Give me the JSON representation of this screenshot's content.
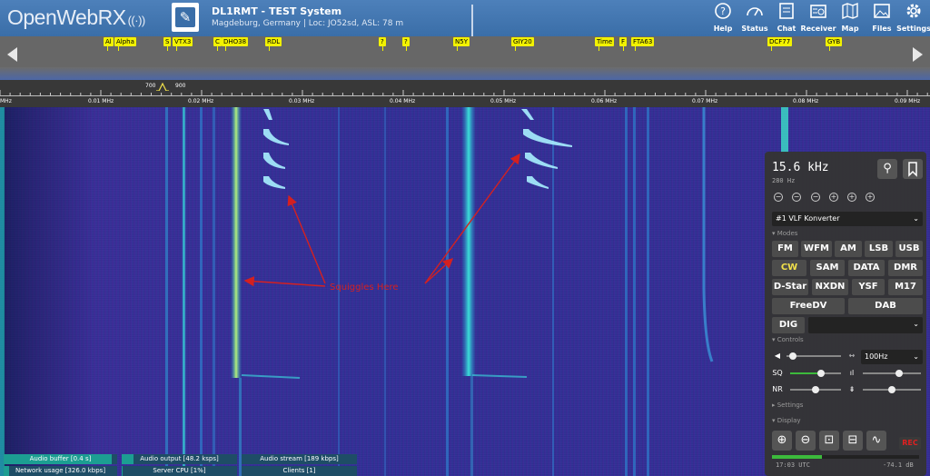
{
  "header": {
    "logo_text": "OpenWebRX",
    "site_name": "DL1RMT - TEST System",
    "site_location": "Magdeburg, Germany | Loc: JO52sd, ASL: 78 m",
    "buttons": [
      {
        "label": "Help",
        "icon": "help-icon"
      },
      {
        "label": "Status",
        "icon": "gauge-icon"
      },
      {
        "label": "Chat",
        "icon": "chat-icon"
      },
      {
        "label": "Receiver",
        "icon": "receiver-icon"
      },
      {
        "label": "Map",
        "icon": "map-icon"
      },
      {
        "label": "Files",
        "icon": "image-icon"
      },
      {
        "label": "Settings",
        "icon": "gear-icon"
      }
    ]
  },
  "bookmarks": [
    "Al",
    "Alpha",
    "S",
    "VTX3",
    "C",
    "DHO38",
    "RDL",
    "?",
    "?",
    "N5Y",
    "GIY20",
    "Time",
    "F",
    "FTA63",
    "DCF77",
    "GYB"
  ],
  "tuning": {
    "left_label": "700",
    "right_label": "900"
  },
  "scale": {
    "labels": [
      "MHz",
      "0.01 MHz",
      "0.02 MHz",
      "0.03 MHz",
      "0.04 MHz",
      "0.05 MHz",
      "0.06 MHz",
      "0.07 MHz",
      "0.08 MHz",
      "0.09 MHz"
    ]
  },
  "annotation": {
    "text": "Squiggles Here",
    "color": "#d42020"
  },
  "status": {
    "audio_buffer": "Audio buffer [0.4 s]",
    "audio_output": "Audio output [48.2 ksps]",
    "audio_stream": "Audio stream [189 kbps]",
    "network_usage": "Network usage [326.0 kbps]",
    "server_cpu": "Server CPU [1%]",
    "clients": "Clients [1]",
    "audio_buffer_fill": 0.95,
    "audio_output_fill": 0.1,
    "audio_stream_fill": 0.0,
    "network_usage_fill": 0.05,
    "server_cpu_fill": 0.01,
    "clients_fill": 0.0
  },
  "panel": {
    "frequency": "15.6 kHz",
    "bandwidth": "280 Hz",
    "steps": [
      "−",
      "−",
      "−",
      "+",
      "+",
      "+"
    ],
    "profile": "#1 VLF Konverter",
    "modes_label": "▾ Modes",
    "modes": [
      {
        "label": "FM",
        "active": false
      },
      {
        "label": "WFM",
        "active": false
      },
      {
        "label": "AM",
        "active": false
      },
      {
        "label": "LSB",
        "active": false
      },
      {
        "label": "USB",
        "active": false
      },
      {
        "label": "CW",
        "active": true
      },
      {
        "label": "SAM",
        "active": false
      },
      {
        "label": "DATA",
        "active": false
      },
      {
        "label": "DMR",
        "active": false
      },
      {
        "label": "D-Star",
        "active": false
      },
      {
        "label": "NXDN",
        "active": false
      },
      {
        "label": "YSF",
        "active": false
      },
      {
        "label": "M17",
        "active": false
      },
      {
        "label": "FreeDV",
        "active": false
      },
      {
        "label": "DAB",
        "active": false
      },
      {
        "label": "DIG",
        "active": false
      }
    ],
    "dig_select": "",
    "controls_label": "▾ Controls",
    "sq_label": "SQ",
    "nr_label": "NR",
    "filter_select": "100Hz",
    "settings_label": "▸ Settings",
    "display_label": "▾ Display",
    "rec_label": "REC",
    "time": "17:03 UTC",
    "db": "-74.1 dB",
    "volume": 0.12,
    "squelch": 0.6,
    "nr": 0.5,
    "eq1": 0.62,
    "eq2": 0.5,
    "eq3": 0.5,
    "signal_level": 0.34
  },
  "colors": {
    "accent": "#f2e14a",
    "waterfall": "#2d2f8e",
    "header": "#3a6ea8",
    "annotation": "#d42020"
  }
}
